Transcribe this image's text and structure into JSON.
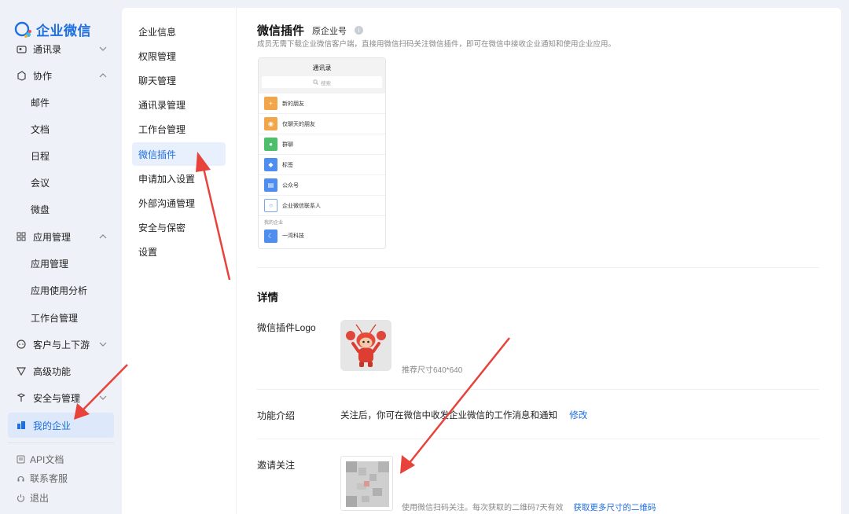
{
  "app": {
    "name": "企业微信",
    "brand_color": "#1f6fe0",
    "active_bg": "#dde8fb"
  },
  "sidebar": {
    "items": [
      {
        "label": "通讯录",
        "icon": "contacts-icon",
        "chevron": "down"
      },
      {
        "label": "协作",
        "icon": "collaborate-icon",
        "chevron": "up"
      },
      {
        "label": "邮件"
      },
      {
        "label": "文档"
      },
      {
        "label": "日程"
      },
      {
        "label": "会议"
      },
      {
        "label": "微盘"
      },
      {
        "label": "应用管理",
        "icon": "apps-icon",
        "chevron": "up"
      },
      {
        "label": "应用管理"
      },
      {
        "label": "应用使用分析"
      },
      {
        "label": "工作台管理"
      },
      {
        "label": "客户与上下游",
        "icon": "customer-icon",
        "chevron": "down"
      },
      {
        "label": "高级功能",
        "icon": "advanced-icon"
      },
      {
        "label": "安全与管理",
        "icon": "security-icon",
        "chevron": "down"
      },
      {
        "label": "我的企业",
        "icon": "enterprise-icon",
        "active": true
      }
    ],
    "footer": [
      {
        "label": "API文档",
        "icon": "api-doc-icon"
      },
      {
        "label": "联系客服",
        "icon": "headset-icon"
      },
      {
        "label": "退出",
        "icon": "power-icon"
      }
    ]
  },
  "subnav": {
    "items": [
      "企业信息",
      "权限管理",
      "聊天管理",
      "通讯录管理",
      "工作台管理",
      "微信插件",
      "申请加入设置",
      "外部沟通管理",
      "安全与保密",
      "设置"
    ],
    "active_index": 5
  },
  "page": {
    "title": "微信插件",
    "subtitle": "原企业号",
    "description": "成员无需下载企业微信客户端，直接用微信扫码关注微信插件，即可在微信中接收企业通知和使用企业应用。"
  },
  "preview": {
    "title": "通讯录",
    "search_placeholder": "搜索",
    "rows": [
      {
        "label": "新的朋友",
        "color": "#f3a54a",
        "icon": "add-friend-icon"
      },
      {
        "label": "仅聊天的朋友",
        "color": "#f3a54a",
        "icon": "chat-friend-icon"
      },
      {
        "label": "群聊",
        "color": "#4cbf6b",
        "icon": "group-icon"
      },
      {
        "label": "标签",
        "color": "#4d8ef0",
        "icon": "tag-icon"
      },
      {
        "label": "公众号",
        "color": "#4d8ef0",
        "icon": "official-account-icon"
      },
      {
        "label": "企业微信联系人",
        "color": "#ffffff",
        "icon": "wecom-contact-icon"
      }
    ],
    "section_label": "我的企业",
    "enterprise": {
      "label": "一湾科技",
      "color": "#4d8ef0"
    }
  },
  "details": {
    "title": "详情",
    "logo_label": "微信插件Logo",
    "logo_hint": "推荐尺寸640*640",
    "func_label": "功能介绍",
    "func_text": "关注后，你可在微信中收发企业微信的工作消息和通知",
    "func_edit": "修改",
    "invite_label": "邀请关注",
    "invite_hint": "使用微信扫码关注。每次获取的二维码7天有效",
    "invite_link": "获取更多尺寸的二维码"
  }
}
